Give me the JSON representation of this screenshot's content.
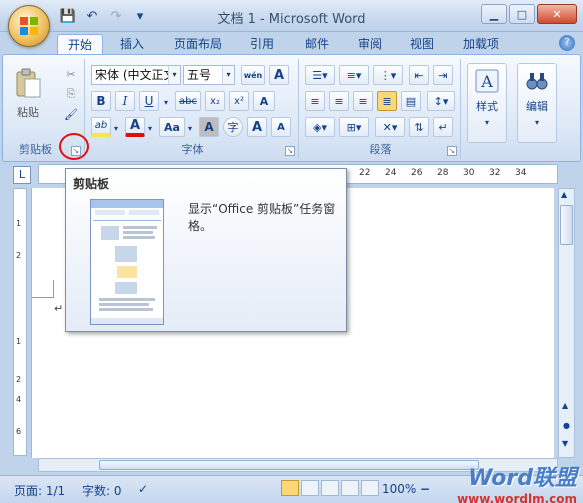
{
  "window": {
    "title": "文档 1 - Microsoft Word",
    "controls": {
      "minimize_icon": "▁",
      "maximize_icon": "□",
      "close_icon": "✕"
    }
  },
  "quick_access": {
    "save_icon": "💾",
    "undo_icon": "↶",
    "redo_icon": "↷",
    "customize_icon": "▾"
  },
  "tabs": [
    {
      "label": "开始",
      "active": true
    },
    {
      "label": "插入"
    },
    {
      "label": "页面布局"
    },
    {
      "label": "引用"
    },
    {
      "label": "邮件"
    },
    {
      "label": "审阅"
    },
    {
      "label": "视图"
    },
    {
      "label": "加载项"
    }
  ],
  "help_icon": "?",
  "ribbon": {
    "clipboard": {
      "label": "剪贴板",
      "paste_label": "粘贴",
      "cut_icon": "✂",
      "copy_icon": "⎘",
      "format_painter_icon": "🖌"
    },
    "font": {
      "label": "字体",
      "font_name": "宋体 (中文正文)",
      "font_size": "五号",
      "wen_icon": "wén",
      "char_border_icon": "A",
      "bold": "B",
      "italic": "I",
      "underline": "U",
      "strike": "abc",
      "subscript": "x₂",
      "superscript": "x²",
      "clear_format_icon": "A",
      "highlight": "ab",
      "font_color": "A",
      "change_case": "Aa",
      "char_shading": "A",
      "enclose": "字",
      "grow": "A",
      "shrink": "A"
    },
    "paragraph": {
      "label": "段落"
    },
    "styles": {
      "label": "样式"
    },
    "editing": {
      "label": "编辑"
    }
  },
  "ruler": {
    "tab_selector": "L",
    "numbers_h": [
      "22",
      "24",
      "26",
      "28",
      "30",
      "32",
      "34"
    ],
    "numbers_v": [
      "1",
      "2",
      "1",
      "2",
      "4",
      "6"
    ]
  },
  "tooltip": {
    "title": "剪贴板",
    "description": "显示“Office 剪贴板”任务窗格。"
  },
  "document": {
    "paragraph_mark": "↵"
  },
  "status": {
    "page": "页面: 1/1",
    "words": "字数: 0",
    "zoom": "100%",
    "zoom_out": "−"
  },
  "watermark": {
    "line1": "Word联盟",
    "line2": "www.wordlm.com"
  },
  "colors": {
    "accent": "#15428b",
    "highlight_yellow": "#f5e74a",
    "font_red": "#e01010",
    "circle_red": "#e01010"
  }
}
